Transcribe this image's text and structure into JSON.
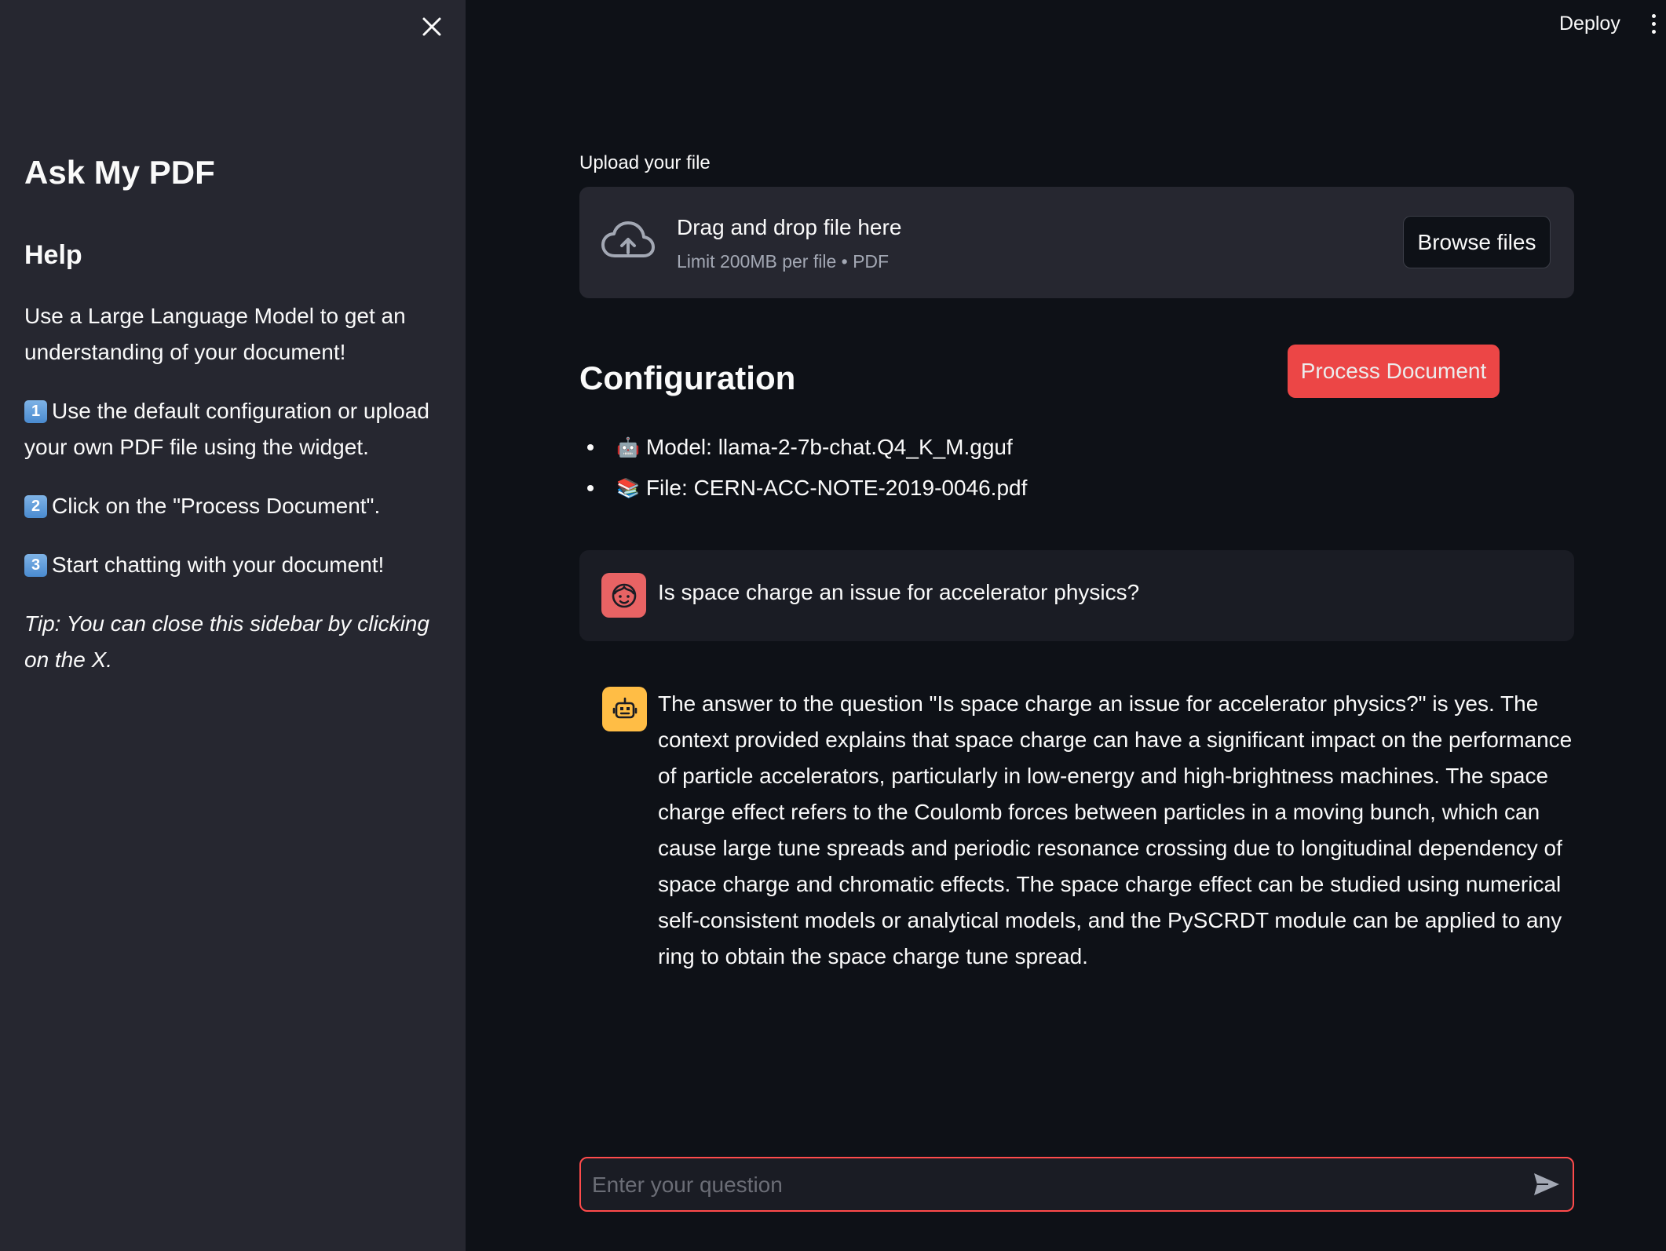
{
  "sidebar": {
    "title": "Ask My PDF",
    "help_heading": "Help",
    "intro": "Use a Large Language Model to get an understanding of your document!",
    "steps": [
      {
        "key": "1",
        "text": "Use the default configuration or upload your own PDF file using the widget."
      },
      {
        "key": "2",
        "text": "Click on the \"Process Document\"."
      },
      {
        "key": "3",
        "text": "Start chatting with your document!"
      }
    ],
    "tip": "Tip: You can close this sidebar by clicking on the X."
  },
  "header": {
    "deploy_label": "Deploy"
  },
  "upload": {
    "label": "Upload your file",
    "drag_text": "Drag and drop file here",
    "limit_text": "Limit 200MB per file • PDF",
    "browse_label": "Browse files"
  },
  "config": {
    "title": "Configuration",
    "process_label": "Process Document",
    "items": [
      {
        "emoji": "🤖",
        "text": "Model: llama-2-7b-chat.Q4_K_M.gguf"
      },
      {
        "emoji": "📚",
        "text": "File: CERN-ACC-NOTE-2019-0046.pdf"
      }
    ]
  },
  "chat": {
    "user_message": "Is space charge an issue for accelerator physics?",
    "bot_message": "The answer to the question \"Is space charge an issue for accelerator physics?\" is yes. The context provided explains that space charge can have a significant impact on the performance of particle accelerators, particularly in low-energy and high-brightness machines. The space charge effect refers to the Coulomb forces between particles in a moving bunch, which can cause large tune spreads and periodic resonance crossing due to longitudinal dependency of space charge and chromatic effects. The space charge effect can be studied using numerical self-consistent models or analytical models, and the PySCRDT module can be applied to any ring to obtain the space charge tune spread.",
    "input_placeholder": "Enter your question",
    "input_value": ""
  },
  "colors": {
    "background": "#0e1117",
    "sidebar": "#262730",
    "accent": "#ff4b4b",
    "bot_avatar": "#ffbd45"
  },
  "icons": {
    "close": "close-icon",
    "upload": "cloud-upload-icon",
    "user_avatar": "user-face-icon",
    "bot_avatar": "robot-icon",
    "send": "send-icon",
    "menu": "kebab-menu-icon"
  }
}
